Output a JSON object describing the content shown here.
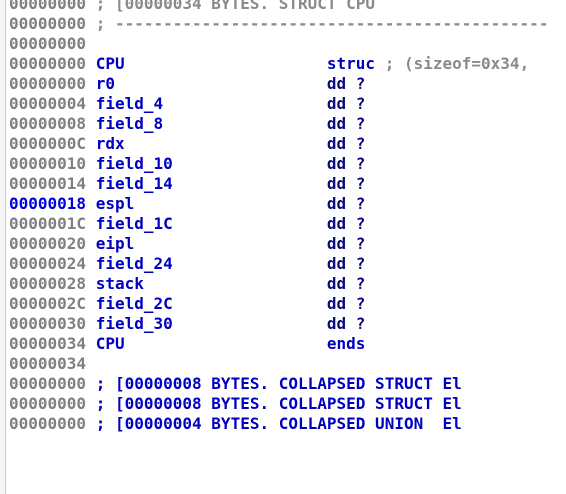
{
  "lines": [
    {
      "addr": "00000000",
      "kind": "comment",
      "text": "; [00000034 BYTES. STRUCT CPU"
    },
    {
      "addr": "00000000",
      "kind": "comment",
      "text": "; ---------------------------------------------"
    },
    {
      "addr": "00000000",
      "kind": "blank"
    },
    {
      "addr": "00000000",
      "kind": "struct",
      "name": "CPU",
      "kw": "struc",
      "comment": "; (sizeof=0x34,"
    },
    {
      "addr": "00000000",
      "kind": "field",
      "name": "r0",
      "op": "dd ?"
    },
    {
      "addr": "00000004",
      "kind": "field",
      "name": "field_4",
      "op": "dd ?"
    },
    {
      "addr": "00000008",
      "kind": "field",
      "name": "field_8",
      "op": "dd ?"
    },
    {
      "addr": "0000000C",
      "kind": "field",
      "name": "rdx",
      "op": "dd ?"
    },
    {
      "addr": "00000010",
      "kind": "field",
      "name": "field_10",
      "op": "dd ?"
    },
    {
      "addr": "00000014",
      "kind": "field",
      "name": "field_14",
      "op": "dd ?"
    },
    {
      "addr": "00000018",
      "kind": "field",
      "name": "espl",
      "op": "dd ?",
      "highlight": true
    },
    {
      "addr": "0000001C",
      "kind": "field",
      "name": "field_1C",
      "op": "dd ?"
    },
    {
      "addr": "00000020",
      "kind": "field",
      "name": "eipl",
      "op": "dd ?"
    },
    {
      "addr": "00000024",
      "kind": "field",
      "name": "field_24",
      "op": "dd ?"
    },
    {
      "addr": "00000028",
      "kind": "field",
      "name": "stack",
      "op": "dd ?"
    },
    {
      "addr": "0000002C",
      "kind": "field",
      "name": "field_2C",
      "op": "dd ?"
    },
    {
      "addr": "00000030",
      "kind": "field",
      "name": "field_30",
      "op": "dd ?"
    },
    {
      "addr": "00000034",
      "kind": "ends",
      "name": "CPU",
      "kw": "ends"
    },
    {
      "addr": "00000034",
      "kind": "blank"
    },
    {
      "addr": "00000000",
      "kind": "collapsed",
      "text": "; [00000008 BYTES. COLLAPSED STRUCT El"
    },
    {
      "addr": "00000000",
      "kind": "collapsed",
      "text": "; [00000008 BYTES. COLLAPSED STRUCT El"
    },
    {
      "addr": "00000000",
      "kind": "collapsed",
      "text": "; [00000004 BYTES. COLLAPSED UNION  El"
    }
  ]
}
